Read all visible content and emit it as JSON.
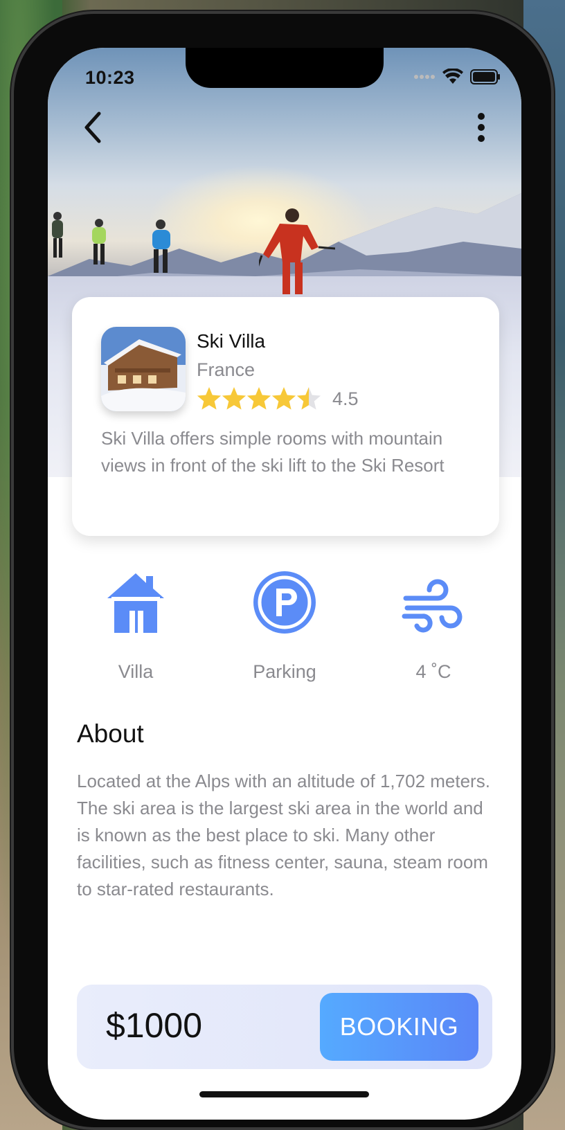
{
  "status_bar": {
    "time": "10:23"
  },
  "header": {
    "back_icon": "chevron-left-icon",
    "more_icon": "more-vertical-icon"
  },
  "villa": {
    "name": "Ski Villa",
    "country": "France",
    "rating": 4.5,
    "rating_text": "4.5",
    "description": "Ski Villa offers simple rooms with mountain views in front of the ski lift to the Ski Resort"
  },
  "amenities": [
    {
      "icon": "house-icon",
      "label": "Villa"
    },
    {
      "icon": "parking-icon",
      "label": "Parking"
    },
    {
      "icon": "wind-icon",
      "label": "4 ˚C"
    }
  ],
  "about": {
    "title": "About",
    "text": "Located at the Alps with an altitude of 1,702 meters. The ski area is the largest ski area in the world and is known as the best place to ski. Many other facilities, such as fitness center, sauna, steam room to star-rated restaurants."
  },
  "booking": {
    "price": "$1000",
    "button_label": "BOOKING"
  },
  "colors": {
    "accent": "#5b8cf7",
    "star": "#f7c838",
    "muted_text": "#8a8a8f"
  }
}
